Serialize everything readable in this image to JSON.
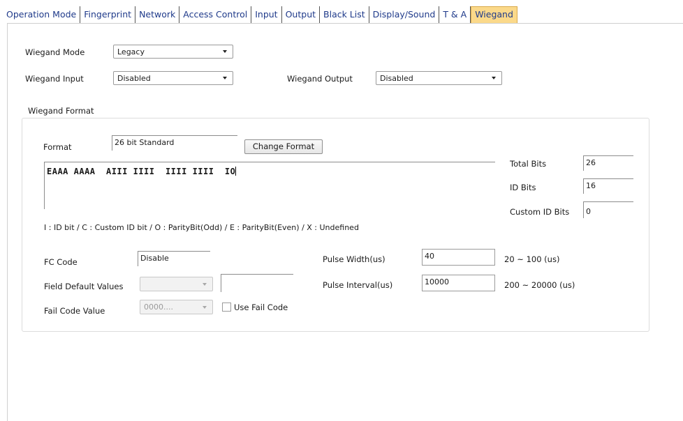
{
  "tabs": [
    {
      "label": "Operation Mode",
      "active": false
    },
    {
      "label": "Fingerprint",
      "active": false
    },
    {
      "label": "Network",
      "active": false
    },
    {
      "label": "Access Control",
      "active": false
    },
    {
      "label": "Input",
      "active": false
    },
    {
      "label": "Output",
      "active": false
    },
    {
      "label": "Black List",
      "active": false
    },
    {
      "label": "Display/Sound",
      "active": false
    },
    {
      "label": "T & A",
      "active": false
    },
    {
      "label": "Wiegand",
      "active": true
    }
  ],
  "wiegand_mode": {
    "label": "Wiegand Mode",
    "value": "Legacy"
  },
  "wiegand_input": {
    "label": "Wiegand Input",
    "value": "Disabled"
  },
  "wiegand_output": {
    "label": "Wiegand Output",
    "value": "Disabled"
  },
  "format_group": {
    "title": "Wiegand Format",
    "format_label": "Format",
    "format_value": "26 bit Standard",
    "change_format_button": "Change Format",
    "bit_map": "EAAA AAAA  AIII IIII  IIII IIII  IO",
    "total_bits": {
      "label": "Total Bits",
      "value": "26"
    },
    "id_bits": {
      "label": "ID Bits",
      "value": "16"
    },
    "custom_id_bits": {
      "label": "Custom ID Bits",
      "value": "0"
    },
    "legend": "I : ID bit  / C : Custom ID bit  / O : ParityBit(Odd)  / E : ParityBit(Even)  / X : Undefined",
    "fc_code": {
      "label": "FC Code",
      "value": "Disable"
    },
    "field_default_values": {
      "label": "Field Default Values",
      "value": "",
      "text": ""
    },
    "fail_code_value": {
      "label": "Fail Code Value",
      "value": "0000...."
    },
    "use_fail_code": {
      "label": "Use Fail Code",
      "checked": false
    },
    "pulse_width": {
      "label": "Pulse Width(us)",
      "value": "40",
      "range": "20 ~ 100 (us)"
    },
    "pulse_interval": {
      "label": "Pulse Interval(us)",
      "value": "10000",
      "range": "200 ~ 20000 (us)"
    }
  },
  "colors": {
    "active_tab": "#fbd98a",
    "tab_text": "#1f3a8a"
  }
}
